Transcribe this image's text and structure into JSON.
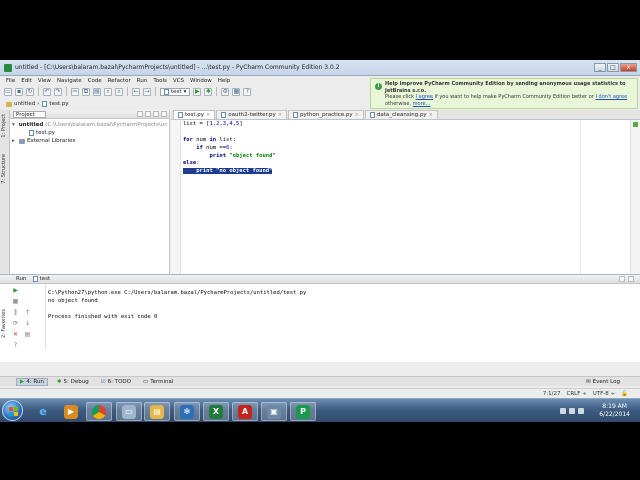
{
  "window": {
    "title": "untitled - [C:\\Users\\balaram.bazal\\PycharmProjects\\untitled] - ...\\test.py - PyCharm Community Edition 3.0.2",
    "buttons": {
      "minimize": "_",
      "maximize": "□",
      "close": "x"
    }
  },
  "menu": [
    "File",
    "Edit",
    "View",
    "Navigate",
    "Code",
    "Refactor",
    "Run",
    "Tools",
    "VCS",
    "Window",
    "Help"
  ],
  "toolbar": {
    "run_config": "test"
  },
  "navbar": {
    "project": "untitled",
    "file": "test.py"
  },
  "notification": {
    "title": "Help improve PyCharm Community Edition by sending anonymous usage statistics to JetBrains s.r.o.",
    "body_pre": "Please click",
    "agree": "I agree",
    "body_mid": "if you want to help make PyCharm Community Edition better or",
    "disagree": "I don't agree",
    "body_post": "otherwise.",
    "more": "more..."
  },
  "project_panel": {
    "selector": "Project",
    "tree": [
      {
        "label": "untitled",
        "path": "(C:\\Users\\balaram.bazal\\PycharmProjects\\untitled)",
        "indent": 0,
        "arrow": "▾",
        "icon": "folder"
      },
      {
        "label": "test.py",
        "path": "",
        "indent": 1,
        "arrow": "",
        "icon": "py"
      },
      {
        "label": "External Libraries",
        "path": "",
        "indent": 0,
        "arrow": "▸",
        "icon": "lib"
      }
    ]
  },
  "side_tabs": {
    "project": "1: Project",
    "structure": "7: Structure",
    "favorites": "2: Favorites"
  },
  "editor": {
    "tabs": [
      {
        "label": "test.py",
        "active": true
      },
      {
        "label": "oauth2-twitter.py",
        "active": false
      },
      {
        "label": "python_practice.py",
        "active": false
      },
      {
        "label": "data_cleansing.py",
        "active": false
      }
    ],
    "code_lines": [
      "list = [1,2,3,4,5]",
      "",
      "for num in list:",
      "    if num ==6:",
      "        print \"object found\"",
      "else:",
      "    print \"no object found\""
    ]
  },
  "run_panel": {
    "title": "Run",
    "config": "test",
    "output": [
      "C:\\Python27\\python.exe C:/Users/balaram.bazal/PycharmProjects/untitled/test.py",
      "no object found",
      "",
      "Process finished with exit code 0"
    ]
  },
  "bottom_tools": {
    "run": "4: Run",
    "debug": "5: Debug",
    "todo": "6: TODO",
    "terminal": "Terminal",
    "event_log": "Event Log"
  },
  "status": {
    "position": "7:1/27",
    "line_sep": "CRLF ÷",
    "encoding": "UTF-8 ÷"
  },
  "taskbar": {
    "time": "8:19 AM",
    "date": "6/22/2014",
    "apps": [
      "ie",
      "media",
      "chrome",
      "pc",
      "folder",
      "vmware",
      "excel",
      "acrobat",
      "network",
      "pycharm"
    ]
  }
}
